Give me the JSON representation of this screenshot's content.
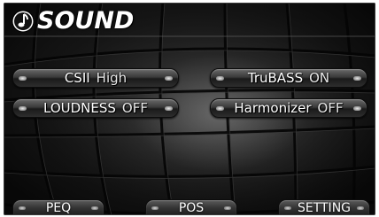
{
  "header": {
    "title": "SOUND",
    "icon": "music-note-icon"
  },
  "settings": {
    "csii": {
      "name": "CSII",
      "state": "High"
    },
    "trubass": {
      "name": "TruBASS",
      "state": "ON"
    },
    "loudness": {
      "name": "LOUDNESS",
      "state": "OFF"
    },
    "harmonizer": {
      "name": "Harmonizer",
      "state": "OFF"
    }
  },
  "bottom_nav": {
    "peq": "PEQ",
    "pos": "POS",
    "setting": "SETTING"
  },
  "colors": {
    "background": "#151515",
    "text": "#ffffff",
    "button": "#3a3a3a"
  }
}
